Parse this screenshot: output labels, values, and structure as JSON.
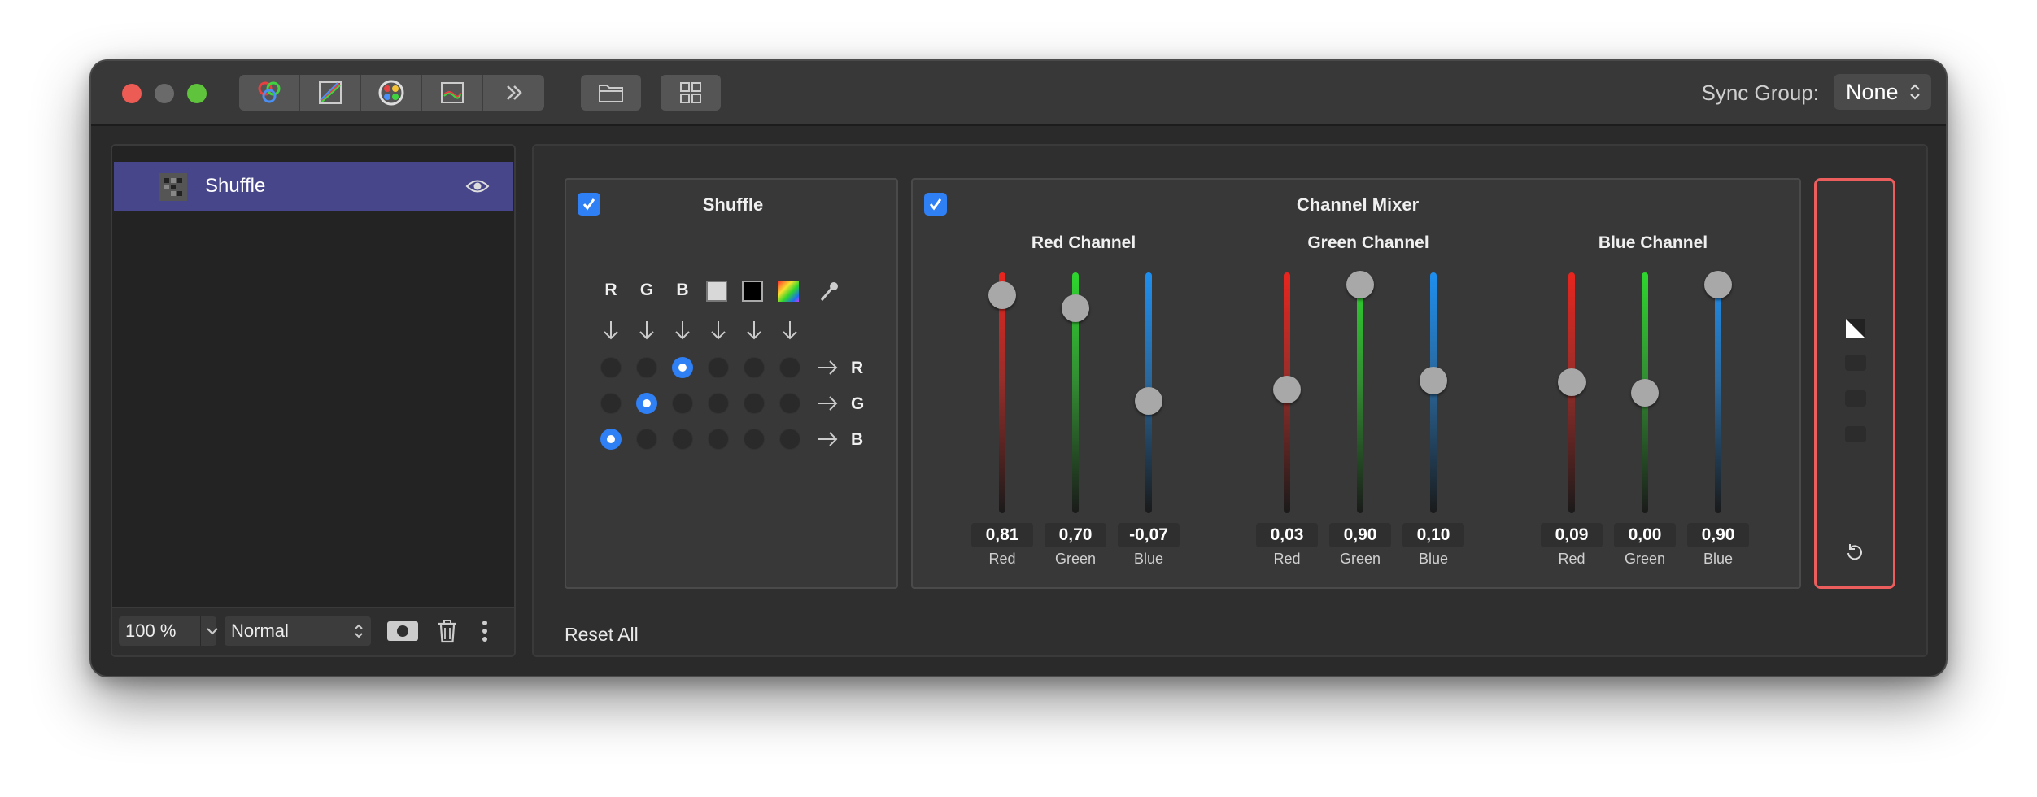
{
  "titlebar": {
    "sync_label": "Sync Group:",
    "sync_value": "None",
    "toolbar_icons": [
      "channels-icon",
      "curves-icon",
      "color-wheel-icon",
      "levels-icon",
      "more-icon"
    ],
    "folder_icon": "folder-icon",
    "grid_icon": "grid-icon"
  },
  "sidebar": {
    "layers": [
      {
        "name": "Shuffle",
        "selected": true
      }
    ],
    "zoom": "100 %",
    "blend_mode": "Normal"
  },
  "shuffle": {
    "title": "Shuffle",
    "enabled": true,
    "columns": [
      "R",
      "G",
      "B"
    ],
    "rows": [
      "R",
      "G",
      "B"
    ],
    "selection": {
      "R": 2,
      "G": 1,
      "B": 0
    },
    "colors": {
      "white": "#d8d8d8",
      "black": "#000000"
    }
  },
  "mixer": {
    "title": "Channel Mixer",
    "enabled": true,
    "channels": [
      {
        "title": "Red Channel",
        "sliders": [
          {
            "label": "Red",
            "value": "0,81",
            "v": 0.81
          },
          {
            "label": "Green",
            "value": "0,70",
            "v": 0.7
          },
          {
            "label": "Blue",
            "value": "-0,07",
            "v": -0.07
          }
        ]
      },
      {
        "title": "Green Channel",
        "sliders": [
          {
            "label": "Red",
            "value": "0,03",
            "v": 0.03
          },
          {
            "label": "Green",
            "value": "0,90",
            "v": 0.9
          },
          {
            "label": "Blue",
            "value": "0,10",
            "v": 0.1
          }
        ]
      },
      {
        "title": "Blue Channel",
        "sliders": [
          {
            "label": "Red",
            "value": "0,09",
            "v": 0.09
          },
          {
            "label": "Green",
            "value": "0,00",
            "v": 0.0
          },
          {
            "label": "Blue",
            "value": "0,90",
            "v": 0.9
          }
        ]
      }
    ],
    "colors": {
      "red": "#e8251e",
      "green": "#2ed62e",
      "blue": "#1e8ff0"
    }
  },
  "reset_all": "Reset All"
}
